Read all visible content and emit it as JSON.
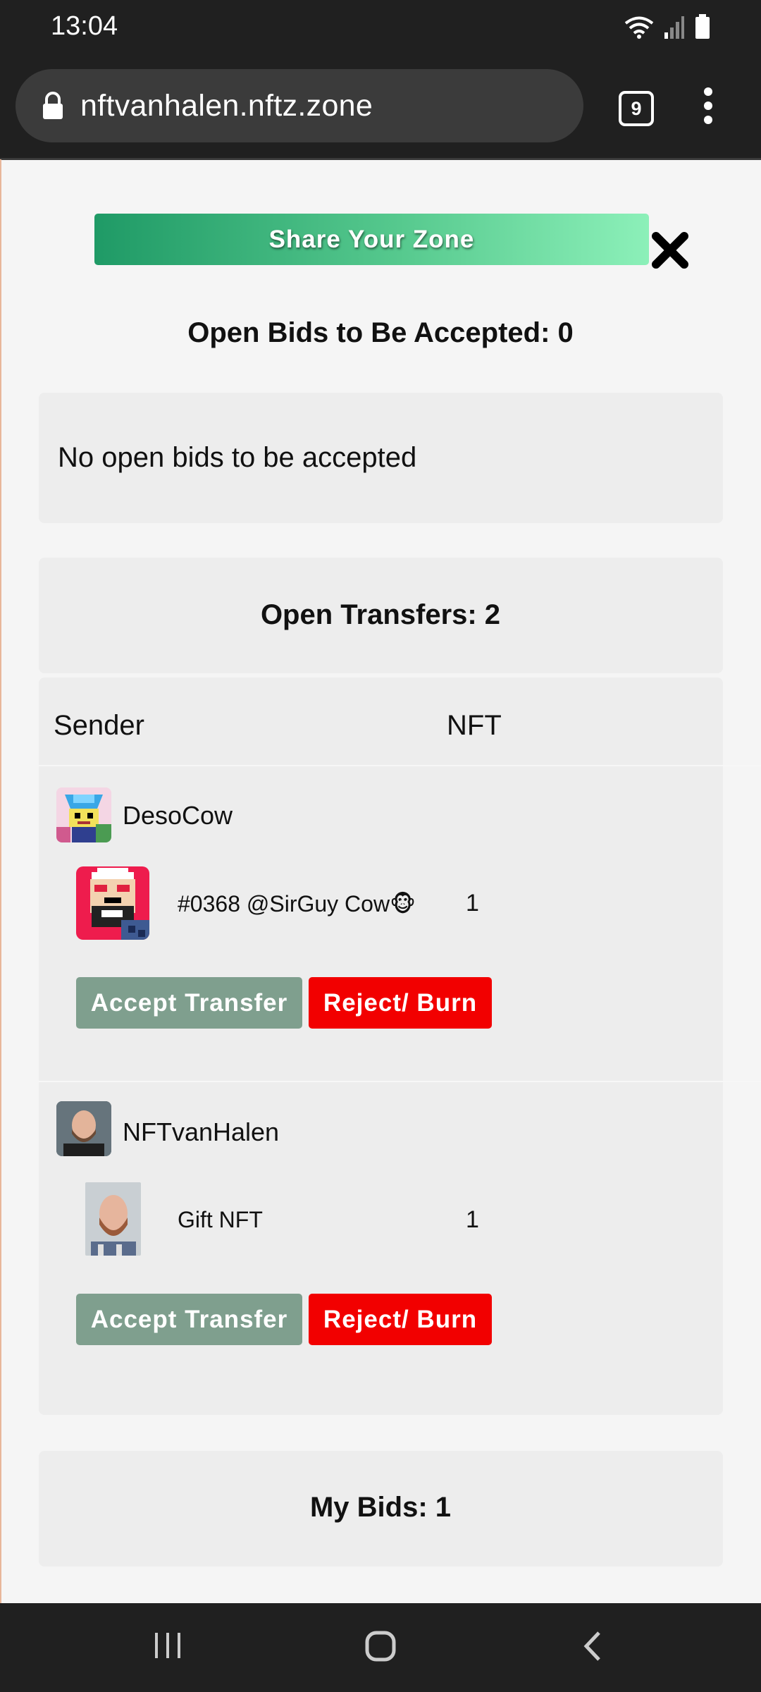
{
  "status_bar": {
    "time": "13:04",
    "icons": [
      "wifi-icon",
      "signal-icon",
      "battery-icon"
    ]
  },
  "browser": {
    "url": "nftvanhalen.nftz.zone",
    "tab_count": "9",
    "icons": [
      "lock-icon",
      "more-menu-icon"
    ]
  },
  "page": {
    "share_button": "Share Your Zone",
    "open_bids_heading": "Open Bids to Be Accepted: 0",
    "no_bids_text": "No open bids to be accepted",
    "open_transfers_heading": "Open Transfers: 2",
    "columns": {
      "sender": "Sender",
      "nft": "NFT"
    },
    "transfers": [
      {
        "sender": "DesoCow",
        "nft_name": "#0368 @SirGuy Cow",
        "nft_emoji": "🐵",
        "quantity": "1",
        "accept_label": "Accept Transfer",
        "reject_label": "Reject/ Burn"
      },
      {
        "sender": "NFTvanHalen",
        "nft_name": "Gift NFT",
        "nft_emoji": "",
        "quantity": "1",
        "accept_label": "Accept Transfer",
        "reject_label": "Reject/ Burn"
      }
    ],
    "my_bids_heading": "My Bids: 1"
  },
  "colors": {
    "accept": "#7f9f8e",
    "reject": "#f20000",
    "share_gradient_start": "#1f9a66",
    "share_gradient_end": "#8cf0b9"
  },
  "nav_bar": {
    "icons": [
      "recent-apps-icon",
      "home-icon",
      "back-icon"
    ]
  }
}
